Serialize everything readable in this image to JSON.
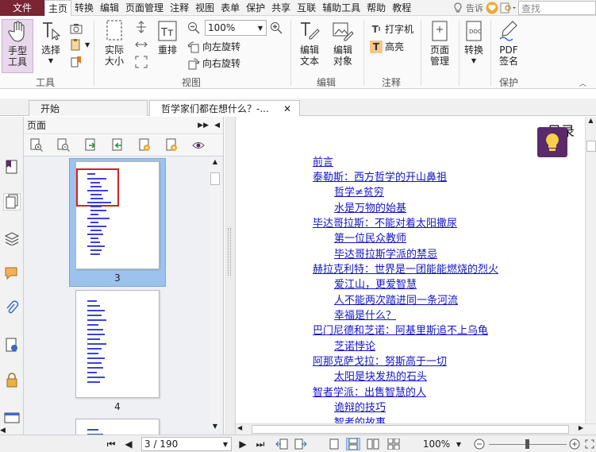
{
  "menubar": {
    "file": "文件",
    "items": [
      "主页",
      "转换",
      "编辑",
      "页面管理",
      "注释",
      "视图",
      "表单",
      "保护",
      "共享",
      "互联",
      "辅助工具",
      "帮助",
      "教程"
    ],
    "active": "主页",
    "tell_me": "告诉",
    "search_placeholder": "查找"
  },
  "ribbon": {
    "hand_tool": "手型\n工具",
    "select": "选择",
    "actual_size": "实际\n大小",
    "reflow": "重排",
    "zoom_value": "100%",
    "rotate_left": "向左旋转",
    "rotate_right": "向右旋转",
    "edit_text": "编辑\n文本",
    "edit_object": "编辑\n对象",
    "typewriter": "打字机",
    "highlight": "高亮",
    "page_mgmt": "页面\n管理",
    "convert": "转换",
    "pdf_sign": "PDF\n签名",
    "groups": {
      "tools": "工具",
      "view": "视图",
      "edit": "编辑",
      "comment": "注释",
      "protect": "保护"
    }
  },
  "tabs": [
    {
      "label": "开始"
    },
    {
      "label": "哲学家们都在想什么？-..."
    }
  ],
  "pages_panel": {
    "title": "页面",
    "thumbnails": [
      {
        "number": "3",
        "selected": true
      },
      {
        "number": "4",
        "selected": false
      }
    ]
  },
  "doc": {
    "heading": "目录",
    "toc": [
      {
        "text": "前言",
        "level": 0
      },
      {
        "text": "泰勒斯：西方哲学的开山鼻祖",
        "level": 0
      },
      {
        "text": "哲学≠贫穷",
        "level": 1
      },
      {
        "text": "水是万物的始基",
        "level": 1
      },
      {
        "text": "毕达哥拉斯：不能对着太阳撒尿",
        "level": 0
      },
      {
        "text": "第一位民众教师",
        "level": 1
      },
      {
        "text": "毕达哥拉斯学派的禁忌",
        "level": 1
      },
      {
        "text": "赫拉克利特：世界是一团能能燃烧的烈火",
        "level": 0
      },
      {
        "text": "爱江山，更爱智慧",
        "level": 1
      },
      {
        "text": "人不能两次踏进同一条河流",
        "level": 1
      },
      {
        "text": "幸福是什么？",
        "level": 1
      },
      {
        "text": "巴门尼德和芝诺：阿基里斯追不上乌龟",
        "level": 0
      },
      {
        "text": "芝诺悖论",
        "level": 1
      },
      {
        "text": "阿那克萨戈拉：努斯高于一切",
        "level": 0
      },
      {
        "text": "太阳是块发热的石头",
        "level": 1
      },
      {
        "text": "智者学派：出售智慧的人",
        "level": 0
      },
      {
        "text": "诡辩的技巧",
        "level": 1
      },
      {
        "text": "智者的故事",
        "level": 1
      }
    ]
  },
  "statusbar": {
    "page": "3 / 190",
    "zoom": "100%"
  },
  "colors": {
    "file_button": "#7a2434",
    "link": "#1414c8",
    "selection": "#9cc3ee",
    "accent_purple": "#5a2a6a"
  }
}
